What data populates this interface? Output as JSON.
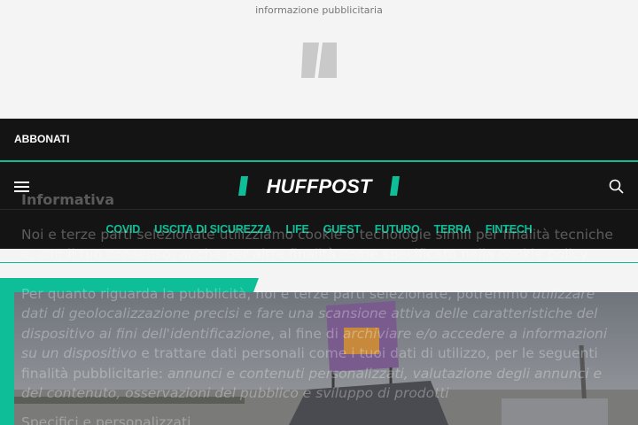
{
  "ad": {
    "label": "informazione pubblicitaria"
  },
  "header": {
    "subscribe_label": "ABBONATI",
    "logo_text": "HUFFPOST",
    "nav": [
      "COVID",
      "USCITA DI SICUREZZA",
      "LIFE",
      "GUEST",
      "FUTURO",
      "TERRA",
      "FINTECH"
    ]
  },
  "consent": {
    "title": "Informativa",
    "p1": "Noi e terze parti selezionate utilizziamo cookie o tecnologie simili per finalità tecniche e, con il tuo consenso, anche per altre finalità come specificato nella cookie policy.",
    "p2a": "Per quanto riguarda la pubblicità, noi e terze parti selezionate, potremmo ",
    "p2b": "utilizzare dati di geolocalizzazione precisi e fare una scansione attiva delle caratteristiche del dispositivo ai fini dell'identificazione",
    "p2c": ", al fine di ",
    "p2d": "archiviare e/o accedere a informazioni su un dispositivo",
    "p2e": " e trattare dati personali come i tuoi dati di utilizzo, per le seguenti finalità pubblicitarie: ",
    "p2f": "annunci e contenuti personalizzati, valutazione degli annunci e del contenuto, osservazioni del pubblico e sviluppo di prodotti",
    "p3": "Specifici e personalizzati"
  },
  "icons": {
    "menu": "hamburger-icon",
    "search": "search-icon",
    "ad": "huffpost-slash-logo-icon"
  },
  "colors": {
    "accent": "#0dbe98",
    "header_bg": "#141414",
    "page_bg": "#f4f4f4"
  }
}
